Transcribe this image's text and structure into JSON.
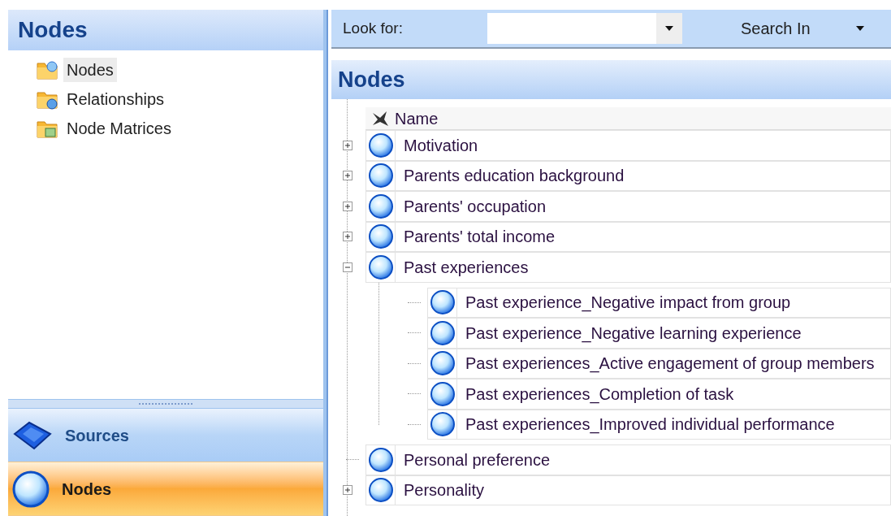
{
  "navigation": {
    "title": "Nodes",
    "items": [
      {
        "label": "Nodes",
        "selected": true
      },
      {
        "label": "Relationships",
        "selected": false
      },
      {
        "label": "Node Matrices",
        "selected": false
      }
    ],
    "sections": [
      {
        "label": "Sources",
        "selected": false
      },
      {
        "label": "Nodes",
        "selected": true
      }
    ]
  },
  "find_bar": {
    "label": "Look for:",
    "search_in": "Search In"
  },
  "list_view": {
    "title": "Nodes",
    "column": "Name",
    "rows": [
      {
        "name": "Motivation",
        "kind": "collapsed"
      },
      {
        "name": "Parents education background",
        "kind": "collapsed"
      },
      {
        "name": "Parents' occupation",
        "kind": "collapsed"
      },
      {
        "name": "Parents' total income",
        "kind": "collapsed"
      },
      {
        "name": "Past experiences",
        "kind": "expanded",
        "children": [
          {
            "name": "Past experience_Negative impact from group",
            "kind": "leaf"
          },
          {
            "name": "Past experience_Negative learning experience",
            "kind": "leaf"
          },
          {
            "name": "Past experiences_Active engagement of group members",
            "kind": "leaf"
          },
          {
            "name": "Past experiences_Completion of task",
            "kind": "leaf"
          },
          {
            "name": "Past experiences_Improved individual performance",
            "kind": "leaf"
          }
        ]
      },
      {
        "name": "Personal preference",
        "kind": "leaf"
      },
      {
        "name": "Personality",
        "kind": "collapsed"
      }
    ]
  }
}
